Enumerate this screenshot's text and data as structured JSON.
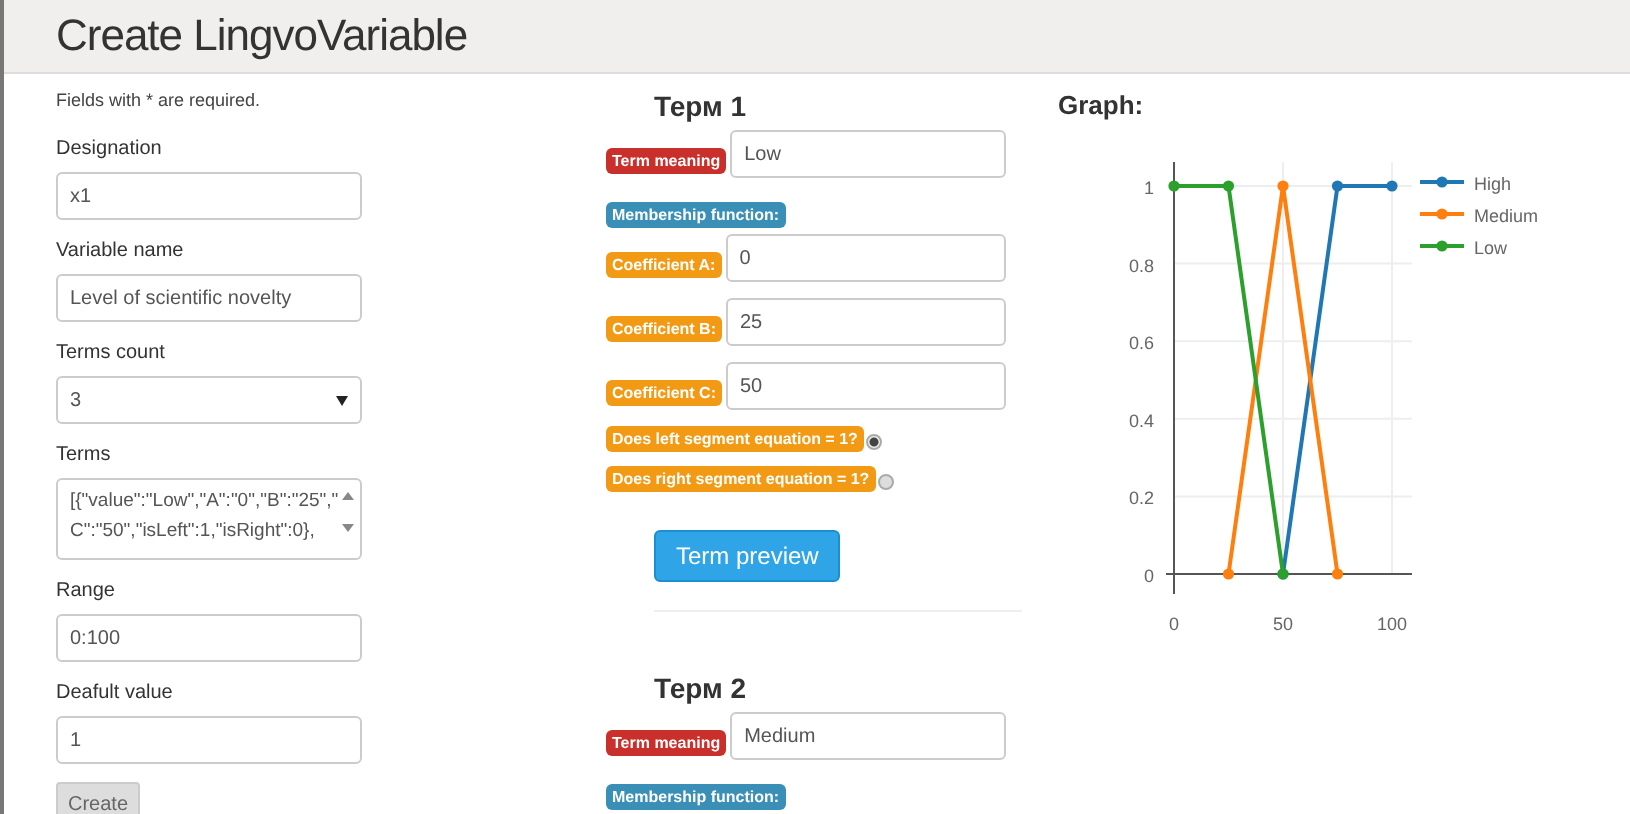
{
  "header": {
    "title": "Create LingvoVariable"
  },
  "form": {
    "note": "Fields with * are required.",
    "fields": [
      {
        "kind": "text",
        "label": "Designation",
        "value": "x1"
      },
      {
        "kind": "text",
        "label": "Variable name",
        "value": "Level of scientific novelty"
      },
      {
        "kind": "select",
        "label": "Terms count",
        "value": "3"
      },
      {
        "kind": "textarea",
        "label": "Terms",
        "lines": [
          "[{\"value\":\"Low\",\"A\":\"0\",\"B\":\"25\",\"",
          "C\":\"50\",\"isLeft\":1,\"isRight\":0},"
        ]
      },
      {
        "kind": "text",
        "label": "Range",
        "value": "0:100"
      },
      {
        "kind": "text",
        "label": "Deafult value",
        "value": "1"
      }
    ],
    "submit": "Create"
  },
  "terms": [
    {
      "heading": "Терм 1",
      "meaning_label": "Term meaning",
      "meaning": "Low",
      "membership_label": "Membership function:",
      "coefficients": [
        {
          "label": "Coefficient A:",
          "value": "0"
        },
        {
          "label": "Coefficient B:",
          "value": "25"
        },
        {
          "label": "Coefficient C:",
          "value": "50"
        }
      ],
      "options": [
        {
          "label": "Does left segment equation = 1?",
          "checked": true
        },
        {
          "label": "Does right segment equation = 1?",
          "checked": false
        }
      ],
      "preview_button": "Term preview"
    },
    {
      "heading": "Терм 2",
      "meaning_label": "Term meaning",
      "meaning": "Medium",
      "membership_label": "Membership function:"
    }
  ],
  "graph": {
    "title": "Graph:",
    "chart_data": {
      "type": "line",
      "grid": true,
      "legend": true,
      "x": [
        0,
        25,
        50,
        75,
        100
      ],
      "xticks": [
        0,
        50,
        100
      ],
      "yticks": [
        0,
        0.2,
        0.4,
        0.6,
        0.8,
        1
      ],
      "xlim": [
        0,
        100
      ],
      "ylim": [
        0,
        1
      ],
      "series": [
        {
          "name": "High",
          "color": "#1f77b4",
          "marker": "circle",
          "values": [
            null,
            null,
            0,
            1,
            1
          ]
        },
        {
          "name": "Medium",
          "color": "#ff7f0e",
          "marker": "circle",
          "values": [
            null,
            0,
            1,
            0,
            null
          ]
        },
        {
          "name": "Low",
          "color": "#2ca02c",
          "marker": "circle",
          "values": [
            1,
            1,
            0,
            null,
            null
          ]
        }
      ]
    }
  }
}
